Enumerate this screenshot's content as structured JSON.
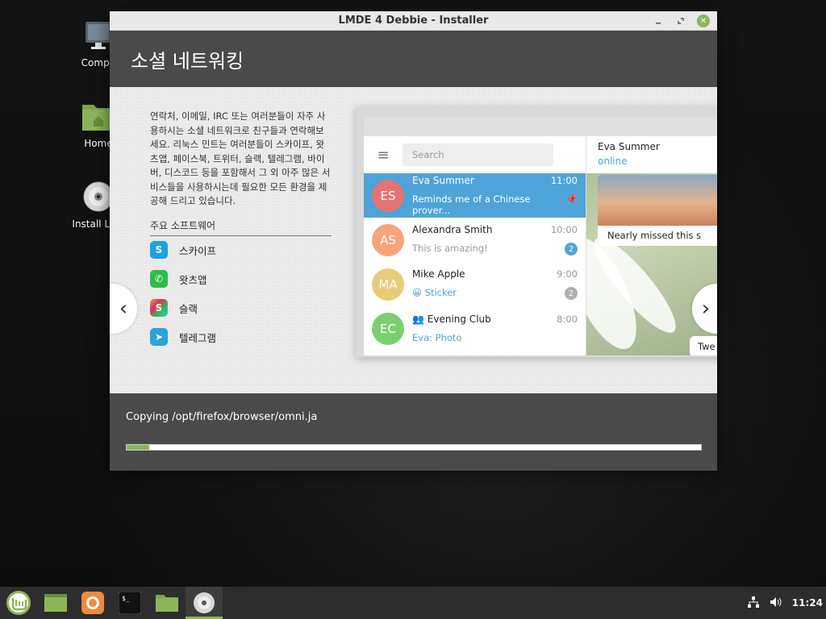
{
  "desktop": {
    "icons": [
      {
        "label": "Compu",
        "icon": "computer-icon"
      },
      {
        "label": "Home",
        "icon": "folder-home-icon"
      },
      {
        "label": "Install Linu",
        "icon": "disc-icon"
      }
    ]
  },
  "window": {
    "title": "LMDE 4 Debbie - Installer",
    "header": "소셜 네트워킹",
    "description": "연락처, 이메일, IRC 또는 여러분들이 자주 사용하시는 소셜 네트워크로 친구들과 연락해보세요. 리눅스 민트는 여러분들이 스카이프, 왓츠앱, 페이스북, 트위터, 슬랙, 텔레그램, 바이버, 디스코드 등을 포함해서 그 외 아주 많은 서비스들을 사용하시는데 필요한 모든 환경을 제공해 드리고 있습니다.",
    "software_heading": "주요 소프트웨어",
    "software": [
      {
        "name": "스카이프",
        "icon": "skype-icon",
        "color": "#1ba3e3"
      },
      {
        "name": "왓츠앱",
        "icon": "whatsapp-icon",
        "color": "#2fbd4b"
      },
      {
        "name": "슬랙",
        "icon": "slack-icon",
        "color": "#e8a23a"
      },
      {
        "name": "텔레그램",
        "icon": "telegram-icon",
        "color": "#2ba4d9"
      }
    ],
    "nav_prev": "‹",
    "nav_next": "›",
    "progress_text": "Copying /opt/firefox/browser/omni.ja",
    "progress": 0.04
  },
  "telegram": {
    "search_placeholder": "Search",
    "chats": [
      {
        "initials": "ES",
        "name": "Eva Summer",
        "time": "11:00",
        "preview": "Reminds me of a Chinese prover...",
        "color": "#e57373",
        "pinned": true
      },
      {
        "initials": "AS",
        "name": "Alexandra Smith",
        "time": "10:00",
        "preview": "This is amazing!",
        "color": "#f6a57a",
        "badge": "2",
        "badge_color": "#4ea4d9"
      },
      {
        "initials": "MA",
        "name": "Mike Apple",
        "time": "9:00",
        "preview": "😀 Sticker",
        "color": "#e8cc7c",
        "badge": "2",
        "badge_color": "#b0b0b0"
      },
      {
        "initials": "EC",
        "name": "Evening Club",
        "time": "8:00",
        "preview": "Eva: Photo",
        "color": "#7ccf6e"
      }
    ],
    "chat_name": "Eva Summer",
    "chat_status": "online",
    "photo_caption": "Nearly missed this s",
    "tweet_text": "Twe"
  },
  "taskbar": {
    "clock": "11:24",
    "accent": "#8cb55a"
  }
}
